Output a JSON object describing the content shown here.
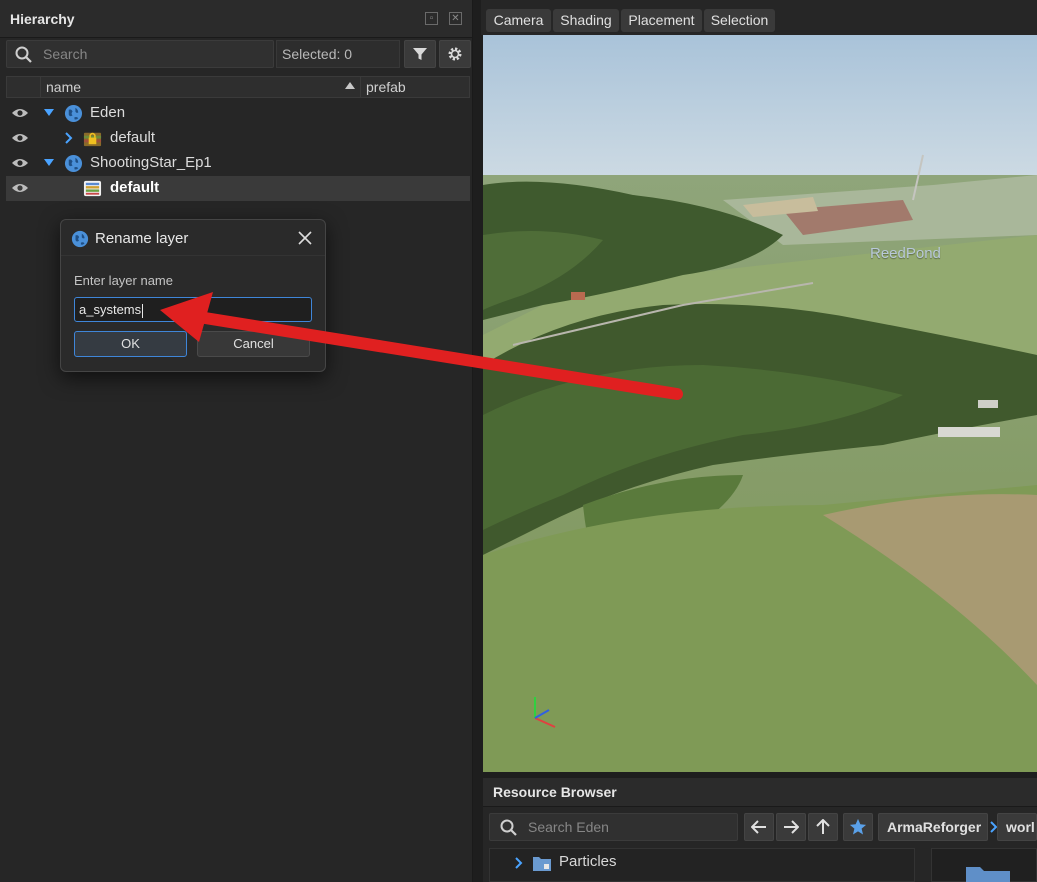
{
  "hierarchy": {
    "title": "Hierarchy",
    "search_placeholder": "Search",
    "selected_label": "Selected: 0",
    "columns": {
      "name": "name",
      "prefab": "prefab"
    },
    "rows": [
      {
        "label": "Eden",
        "icon": "globe-icon",
        "expanded": true
      },
      {
        "label": "default",
        "icon": "lock-layer-icon",
        "expanded": false
      },
      {
        "label": "ShootingStar_Ep1",
        "icon": "globe-icon",
        "expanded": true
      },
      {
        "label": "default",
        "icon": "layer-stack-icon",
        "selected": true
      }
    ]
  },
  "dialog": {
    "title": "Rename layer",
    "prompt": "Enter layer name",
    "value": "a_systems",
    "ok_label": "OK",
    "cancel_label": "Cancel"
  },
  "viewport": {
    "tabs": [
      "Camera",
      "Shading",
      "Placement",
      "Selection"
    ],
    "map_label": "ReedPond"
  },
  "resource_browser": {
    "title": "Resource Browser",
    "search_placeholder": "Search Eden",
    "breadcrumbs": [
      "ArmaReforger",
      "worl"
    ],
    "items": [
      {
        "label": "Particles"
      }
    ]
  },
  "colors": {
    "accent": "#3f86d9",
    "annotation_arrow": "#e02020",
    "globe": "#4a90d9",
    "panel_bg": "#262626"
  }
}
